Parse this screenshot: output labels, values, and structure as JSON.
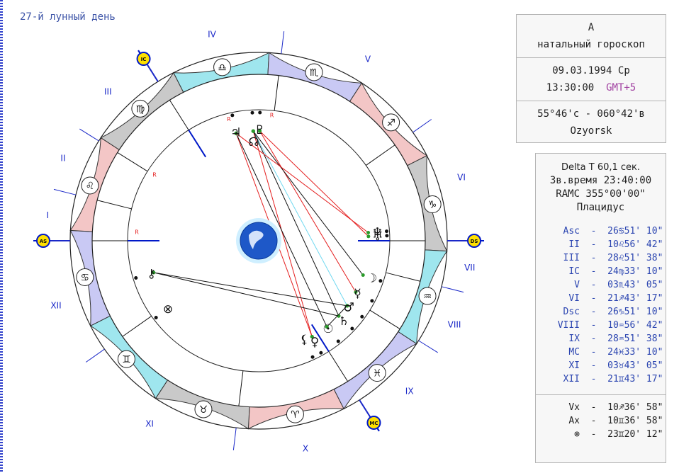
{
  "lunar_day": "27-й лунный день",
  "info": {
    "name": "A",
    "chart_type": "натальный гороскоп",
    "date": "09.03.1994 Ср",
    "time": "13:30:00",
    "gmt": "GMT+5",
    "coords": "55°46'с - 060°42'в",
    "place": "Ozyorsk"
  },
  "tech": {
    "delta_t": "Delta T 60,1 сек.",
    "sidereal": "Зв.время 23:40:00",
    "ramc": "RAMC 355°00'00\"",
    "system": "Плацидус"
  },
  "houses": [
    {
      "label": "Asc",
      "value": "26♋51' 10\""
    },
    {
      "label": "II",
      "value": "10♌56' 42\""
    },
    {
      "label": "III",
      "value": "28♌51' 38\""
    },
    {
      "label": "IC",
      "value": "24♍33' 10\""
    },
    {
      "label": "V",
      "value": "03♏43' 05\""
    },
    {
      "label": "VI",
      "value": "21♐43' 17\""
    },
    {
      "label": "Dsc",
      "value": "26♑51' 10\""
    },
    {
      "label": "VIII",
      "value": "10♒56' 42\""
    },
    {
      "label": "IX",
      "value": "28♒51' 38\""
    },
    {
      "label": "MC",
      "value": "24♓33' 10\""
    },
    {
      "label": "XI",
      "value": "03♉43' 05\""
    },
    {
      "label": "XII",
      "value": "21♊43' 17\""
    }
  ],
  "angles": [
    {
      "label": "Vx",
      "value": "10♐36' 58\""
    },
    {
      "label": "Ax",
      "value": "10♊36' 58\""
    },
    {
      "label": "⊗",
      "value": "23♊20' 12\""
    }
  ],
  "wheel": {
    "house_numerals": [
      "I",
      "II",
      "III",
      "IV",
      "V",
      "VI",
      "VII",
      "VIII",
      "IX",
      "X",
      "XI",
      "XII"
    ],
    "angle_badges": [
      "AS",
      "IC",
      "DS",
      "MC"
    ],
    "sign_glyphs": [
      "♈",
      "♉",
      "♊",
      "♋",
      "♌",
      "♍",
      "♎",
      "♏",
      "♐",
      "♑",
      "♒",
      "♓"
    ],
    "planet_glyphs": {
      "sun": "☉",
      "moon": "☽",
      "mercury": "☿",
      "venus": "♀",
      "mars": "♂",
      "jupiter": "♃",
      "saturn": "♄",
      "uranus": "♅",
      "neptune": "♆",
      "pluto": "♇",
      "node": "☊",
      "lilith": "⚸",
      "chiron": "⚷",
      "fortune": "⊗"
    },
    "retro_mark": "R",
    "colors": {
      "fire": "#f3c6c6",
      "earth": "#c9c9c9",
      "air": "#9fe6ee",
      "water": "#c9c9f4",
      "axis": "#0018c8",
      "cusp": "#1a28c8",
      "red": "#e41e1e",
      "sky": "#70d8f0",
      "badge": "#ffe000"
    }
  }
}
